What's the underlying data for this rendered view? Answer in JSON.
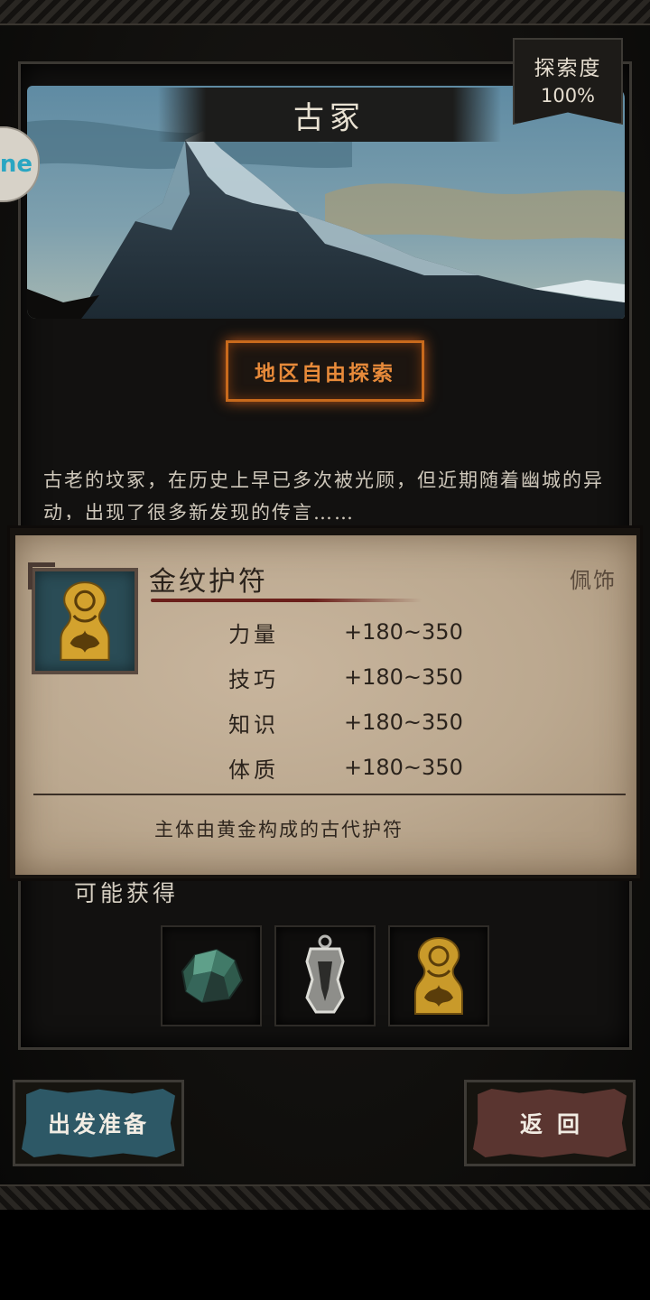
{
  "location": {
    "title": "古冢",
    "progress_label": "探索度",
    "progress_value": "100%",
    "explore_button": "地区自由探索",
    "description": "古老的坟冢，在历史上早已多次被光顾，但近期随着幽城的异动，出现了很多新发现的传言……"
  },
  "side_badge": {
    "text": "ne"
  },
  "loot": {
    "label": "可能获得",
    "items": [
      {
        "icon": "green-ore-icon"
      },
      {
        "icon": "silver-pendant-icon"
      },
      {
        "icon": "gold-amulet-icon"
      }
    ]
  },
  "tooltip": {
    "name": "金纹护符",
    "type": "佩饰",
    "icon": "gold-amulet-icon",
    "stats": [
      {
        "name": "力量",
        "value": "+180~350"
      },
      {
        "name": "技巧",
        "value": "+180~350"
      },
      {
        "name": "知识",
        "value": "+180~350"
      },
      {
        "name": "体质",
        "value": "+180~350"
      }
    ],
    "description": "主体由黄金构成的古代护符"
  },
  "buttons": {
    "depart": "出发准备",
    "return": "返回"
  },
  "colors": {
    "explore_accent": "#c86a1c",
    "depart_bg": "#2d5866",
    "return_bg": "#5a3530",
    "paper": "#bba88f"
  }
}
